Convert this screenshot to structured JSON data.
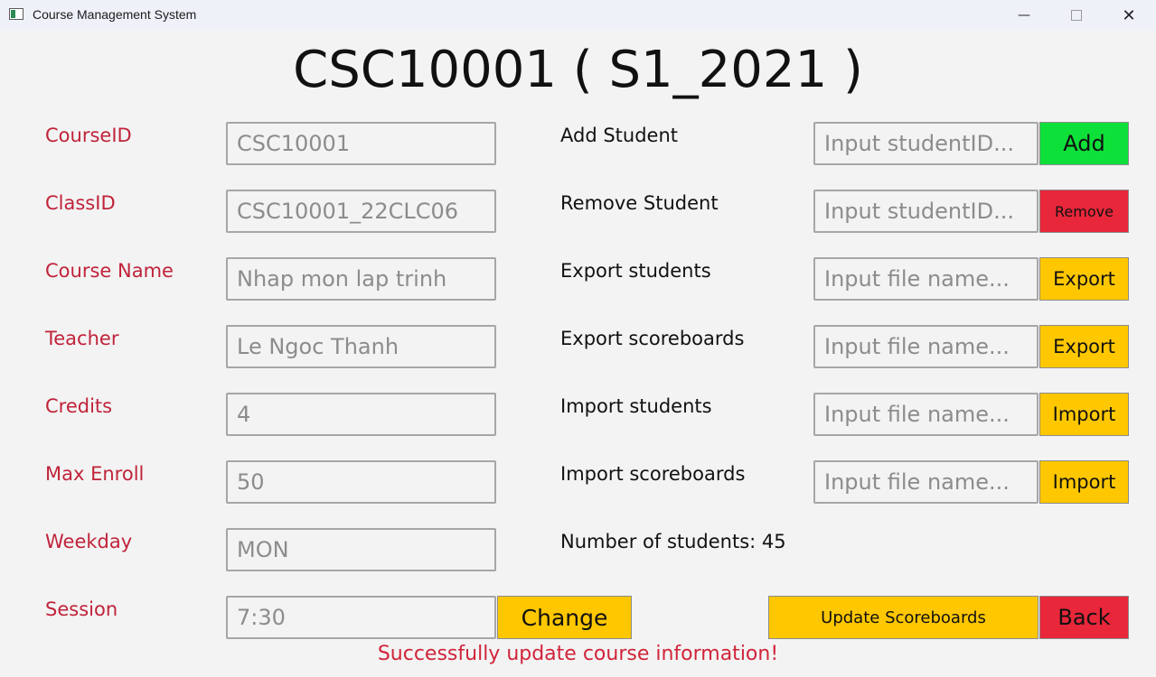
{
  "window": {
    "title": "Course Management System",
    "minimize_glyph": "—",
    "close_glyph": "✕"
  },
  "heading": "CSC10001 ( S1_2021 )",
  "course_info": {
    "course_id": {
      "label": "CourseID",
      "value": "CSC10001"
    },
    "class_id": {
      "label": "ClassID",
      "value": "CSC10001_22CLC06"
    },
    "course_name": {
      "label": "Course Name",
      "value": "Nhap mon lap trinh"
    },
    "teacher": {
      "label": "Teacher",
      "value": "Le Ngoc Thanh"
    },
    "credits": {
      "label": "Credits",
      "value": "4"
    },
    "max_enroll": {
      "label": "Max Enroll",
      "value": "50"
    },
    "weekday": {
      "label": "Weekday",
      "value": "MON"
    },
    "session": {
      "label": "Session",
      "value": "7:30"
    }
  },
  "actions": {
    "add_student": {
      "label": "Add Student",
      "placeholder": "Input studentID...",
      "button": "Add"
    },
    "remove_student": {
      "label": "Remove Student",
      "placeholder": "Input studentID...",
      "button": "Remove"
    },
    "export_students": {
      "label": "Export students",
      "placeholder": "Input file name...",
      "button": "Export"
    },
    "export_scoreboards": {
      "label": "Export scoreboards",
      "placeholder": "Input file name...",
      "button": "Export"
    },
    "import_students": {
      "label": "Import students",
      "placeholder": "Input file name...",
      "button": "Import"
    },
    "import_scoreboards": {
      "label": "Import scoreboards",
      "placeholder": "Input file name...",
      "button": "Import"
    }
  },
  "student_count_text": "Number of students: 45",
  "buttons": {
    "change": "Change",
    "update_scoreboards": "Update Scoreboards",
    "back": "Back"
  },
  "status_message": "Successfully update course information!",
  "colors": {
    "label_red": "#c0233a",
    "button_yellow": "#ffc700",
    "button_green": "#0ee03a",
    "button_red": "#e8273a",
    "message_red": "#d0243a"
  }
}
